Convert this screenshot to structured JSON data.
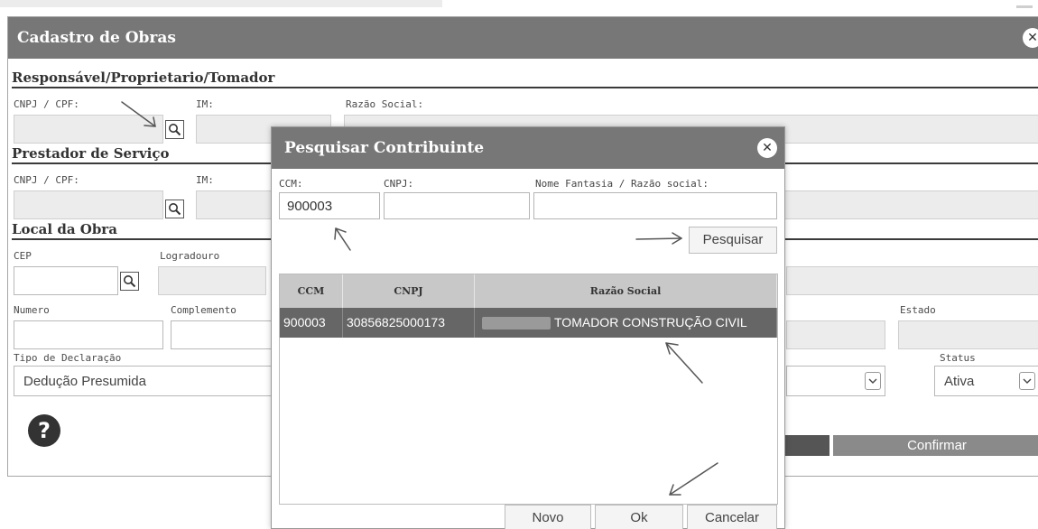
{
  "main": {
    "title": "Cadastro de Obras",
    "sections": {
      "responsavel": {
        "title": "Responsável/Proprietario/Tomador",
        "cnpj_label": "CNPJ / CPF:",
        "im_label": "IM:",
        "razao_label": "Razão Social:"
      },
      "prestador": {
        "title": "Prestador de Serviço",
        "cnpj_label": "CNPJ / CPF:",
        "im_label": "IM:"
      },
      "local": {
        "title": "Local da Obra",
        "cep_label": "CEP",
        "logradouro_label": "Logradouro",
        "numero_label": "Numero",
        "complemento_label": "Complemento",
        "estado_label": "Estado"
      },
      "declaracao": {
        "tipo_label": "Tipo de Declaração",
        "tipo_value": "Dedução Presumida",
        "status_label": "Status",
        "status_value": "Ativa"
      }
    },
    "confirm_label": "Confirmar"
  },
  "modal": {
    "title": "Pesquisar Contribuinte",
    "ccm_label": "CCM:",
    "ccm_value": "900003",
    "cnpj_label": "CNPJ:",
    "cnpj_value": "",
    "nome_label": "Nome Fantasia / Razão social:",
    "nome_value": "",
    "search_button": "Pesquisar",
    "grid": {
      "columns": [
        "CCM",
        "CNPJ",
        "Razão Social"
      ],
      "rows": [
        {
          "ccm": "900003",
          "cnpj": "30856825000173",
          "razao": "TOMADOR CONSTRUÇÃO CIVIL"
        }
      ]
    },
    "buttons": {
      "novo": "Novo",
      "ok": "Ok",
      "cancelar": "Cancelar"
    }
  },
  "icons": {
    "close": "close-icon",
    "search": "magnifier-icon",
    "help": "help-icon",
    "dropdown": "chevron-down-icon"
  }
}
